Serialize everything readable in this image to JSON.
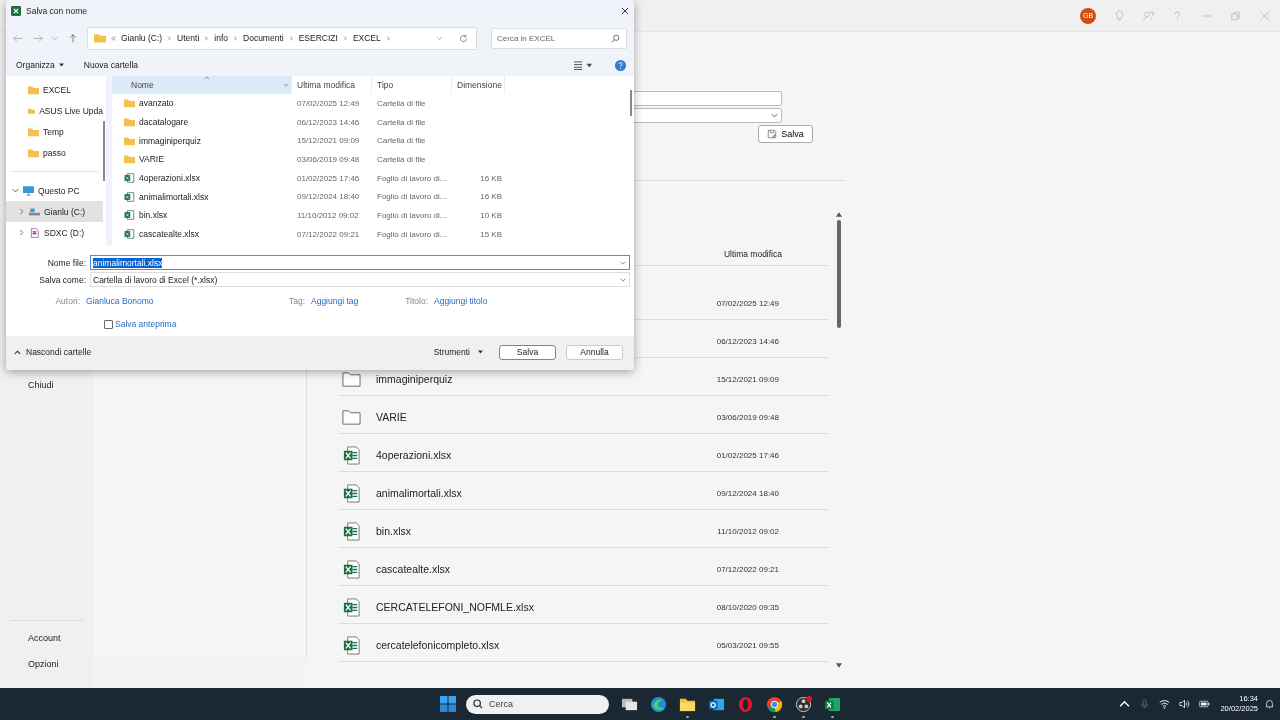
{
  "app": {
    "account_initials": "GB",
    "nav": {
      "top": [
        "Chiudi"
      ],
      "bottom": [
        "Account",
        "Opzioni"
      ]
    },
    "save_button": "Salva",
    "file_list": {
      "header": "Ultima modifica",
      "rows": [
        {
          "kind": "hidden",
          "date": "07/02/2025 12:49"
        },
        {
          "kind": "hidden",
          "date": "06/12/2023 14:46"
        },
        {
          "kind": "folder",
          "name": "immaginiperquiz",
          "date": "15/12/2021 09:09"
        },
        {
          "kind": "folder",
          "name": "VARIE",
          "date": "03/06/2019 09:48"
        },
        {
          "kind": "xlsx",
          "name": "4operazioni.xlsx",
          "date": "01/02/2025 17:46"
        },
        {
          "kind": "xlsx",
          "name": "animalimortali.xlsx",
          "date": "09/12/2024 18:40"
        },
        {
          "kind": "xlsx",
          "name": "bin.xlsx",
          "date": "11/10/2012 09:02"
        },
        {
          "kind": "xlsx",
          "name": "cascatealte.xlsx",
          "date": "07/12/2022 09:21"
        },
        {
          "kind": "xlsx",
          "name": "CERCATELEFONI_NOFMLE.xlsx",
          "date": "08/10/2020 09:35"
        },
        {
          "kind": "xlsx",
          "name": "cercatelefonicompleto.xlsx",
          "date": "05/03/2021 09:55"
        }
      ]
    }
  },
  "dialog": {
    "title": "Salva con nome",
    "breadcrumb": [
      "Gianlu (C:)",
      "Utenti",
      "info",
      "Documenti",
      "ESERCIZI",
      "EXCEL"
    ],
    "search": {
      "placeholder": "Cerca in EXCEL"
    },
    "toolbar": [
      "Organizza",
      "Nuova cartella"
    ],
    "nav_pane": [
      {
        "kind": "folder",
        "label": "EXCEL",
        "selected": false
      },
      {
        "kind": "folder",
        "label": "ASUS Live Upda",
        "selected": false
      },
      {
        "kind": "folder",
        "label": "Temp",
        "selected": false
      },
      {
        "kind": "folder",
        "label": "passo",
        "selected": false
      },
      {
        "kind": "pc",
        "label": "Questo PC",
        "selected": false,
        "expanded": true,
        "children": [
          {
            "kind": "drive",
            "label": "Gianlu (C:)",
            "selected": true,
            "expanded": false
          },
          {
            "kind": "sd",
            "label": "SDXC (D:)",
            "selected": false,
            "expanded": false
          }
        ]
      }
    ],
    "columns": [
      {
        "label": "Nome",
        "sorted": true
      },
      {
        "label": "Ultima modifica",
        "sorted": false
      },
      {
        "label": "Tipo",
        "sorted": false
      },
      {
        "label": "Dimensione",
        "sorted": false
      }
    ],
    "files": [
      {
        "kind": "folder",
        "name": "avanzato",
        "date": "07/02/2025 12:49",
        "type": "Cartella di file"
      },
      {
        "kind": "folder",
        "name": "dacatalogare",
        "date": "06/12/2023 14:46",
        "type": "Cartella di file"
      },
      {
        "kind": "folder",
        "name": "immaginiperquiz",
        "date": "15/12/2021 09:09",
        "type": "Cartella di file"
      },
      {
        "kind": "folder",
        "name": "VARIE",
        "date": "03/06/2019 09:48",
        "type": "Cartella di file"
      },
      {
        "kind": "xlsx",
        "name": "4operazioni.xlsx",
        "date": "01/02/2025 17:46",
        "type": "Foglio di lavoro di...",
        "size": "16 KB"
      },
      {
        "kind": "xlsx",
        "name": "animalimortali.xlsx",
        "date": "09/12/2024 18:40",
        "type": "Foglio di lavoro di...",
        "size": "16 KB"
      },
      {
        "kind": "xlsx",
        "name": "bin.xlsx",
        "date": "11/10/2012 09:02",
        "type": "Foglio di lavoro di...",
        "size": "10 KB"
      },
      {
        "kind": "xlsx",
        "name": "cascatealte.xlsx",
        "date": "07/12/2022 09:21",
        "type": "Foglio di lavoro di...",
        "size": "15 KB"
      }
    ],
    "file_name": {
      "label": "Nome file:",
      "value": "animalimortali.xlsx",
      "text_selected": true
    },
    "save_as": {
      "label": "Salva come:",
      "value": "Cartella di lavoro di Excel (*.xlsx)"
    },
    "meta": [
      {
        "label": "Autori:",
        "value": "Gianluca Bonomo"
      },
      {
        "label": "Tag:",
        "value": "Aggiungi tag"
      },
      {
        "label": "Titolo:",
        "value": "Aggiungi titolo"
      }
    ],
    "preview_checkbox": {
      "label": "Salva anteprima",
      "checked": false
    },
    "hide_folders": "Nascondi cartelle",
    "tools": "Strumenti",
    "buttons": [
      {
        "label": "Salva",
        "primary": true
      },
      {
        "label": "Annulla",
        "primary": false
      }
    ]
  },
  "taskbar": {
    "search": {
      "placeholder": "Cerca"
    },
    "apps": [
      {
        "kind": "taskview",
        "running": false
      },
      {
        "kind": "edge",
        "running": false
      },
      {
        "kind": "explorer",
        "running": true
      },
      {
        "kind": "outlook",
        "running": false
      },
      {
        "kind": "opera",
        "running": false
      },
      {
        "kind": "chrome",
        "running": true
      },
      {
        "kind": "obs",
        "running": true
      },
      {
        "kind": "excel",
        "running": true
      }
    ],
    "time": "16:34",
    "date": "20/02/2025"
  }
}
